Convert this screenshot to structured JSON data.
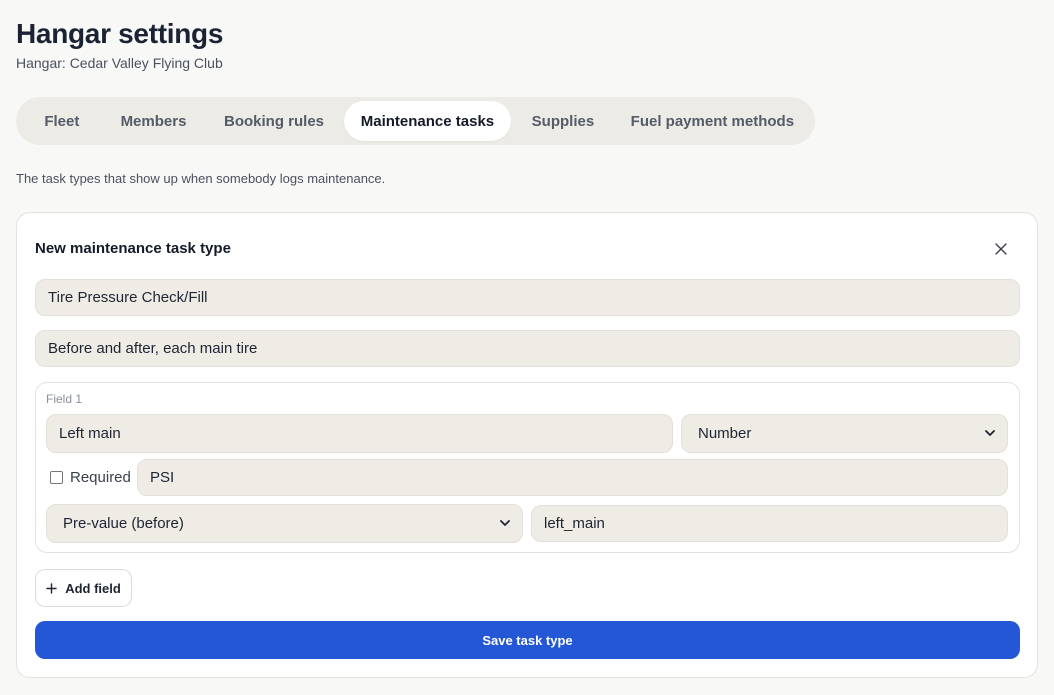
{
  "header": {
    "title": "Hangar settings",
    "subtitle": "Hangar: Cedar Valley Flying Club"
  },
  "tabs": [
    {
      "label": "Fleet",
      "active": false
    },
    {
      "label": "Members",
      "active": false
    },
    {
      "label": "Booking rules",
      "active": false
    },
    {
      "label": "Maintenance tasks",
      "active": true
    },
    {
      "label": "Supplies",
      "active": false
    },
    {
      "label": "Fuel payment methods",
      "active": false
    }
  ],
  "description": "The task types that show up when somebody logs maintenance.",
  "form": {
    "title": "New maintenance task type",
    "close_icon": "close-icon",
    "name_value": "Tire Pressure Check/Fill",
    "description_value": "Before and after, each main tire",
    "fields": [
      {
        "caption": "Field 1",
        "label_value": "Left main",
        "type_value": "Number",
        "required_label": "Required",
        "required_checked": false,
        "unit_value": "PSI",
        "timing_value": "Pre-value (before)",
        "key_value": "left_main"
      }
    ],
    "add_field_label": "Add field",
    "save_label": "Save task type"
  },
  "colors": {
    "background": "#f8f8f6",
    "accent": "#2457d6",
    "input_bg": "#eeece5"
  }
}
